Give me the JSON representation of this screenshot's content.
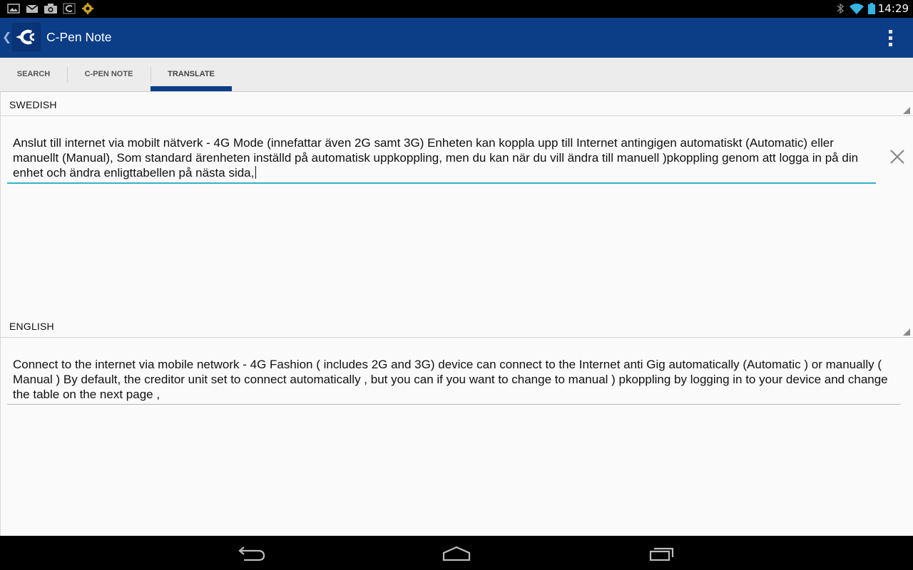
{
  "status_bar": {
    "left_icons": [
      "gallery-icon",
      "gmail-icon",
      "camera-icon",
      "cpen-icon",
      "settings-gear-icon"
    ],
    "right_icons": [
      "bluetooth-icon",
      "wifi-icon",
      "battery-icon"
    ],
    "time": "14:29"
  },
  "action_bar": {
    "title": "C-Pen Note",
    "logo_icon": "cpen-logo-icon",
    "overflow_icon": "overflow-menu-icon"
  },
  "tabs": [
    {
      "label": "SEARCH",
      "active": false
    },
    {
      "label": "C-PEN NOTE",
      "active": false
    },
    {
      "label": "TRANSLATE",
      "active": true
    }
  ],
  "source": {
    "language": "SWEDISH",
    "text": "Anslut till internet via mobilt nätverk - 4G Mode (innefattar även 2G samt 3G) Enheten kan koppla upp till Internet antingigen automatiskt (Automatic) eller manuellt (Manual), Som standard ärenheten inställd på automatisk uppkoppling, men du kan när du vill ändra till manuell )pkoppling genom att logga in på din enhet och ändra enligttabellen på nästa sida,",
    "clear_icon": "close-icon"
  },
  "target": {
    "language": "ENGLISH",
    "text": "Connect to the internet via mobile network - 4G Fashion ( includes 2G and 3G) device can connect to the Internet anti Gig automatically (Automatic ) or manually ( Manual ) By default, the creditor unit set to connect automatically , but you can if you want to change to manual ) pkoppling by logging in to your device and change the table on the next page ,"
  },
  "nav_bar": {
    "icons": [
      "back-icon",
      "home-icon",
      "recent-apps-icon"
    ]
  },
  "colors": {
    "action_bar": "#0c3d87",
    "tab_indicator": "#0c3d87",
    "input_focus": "#35b2c8"
  }
}
